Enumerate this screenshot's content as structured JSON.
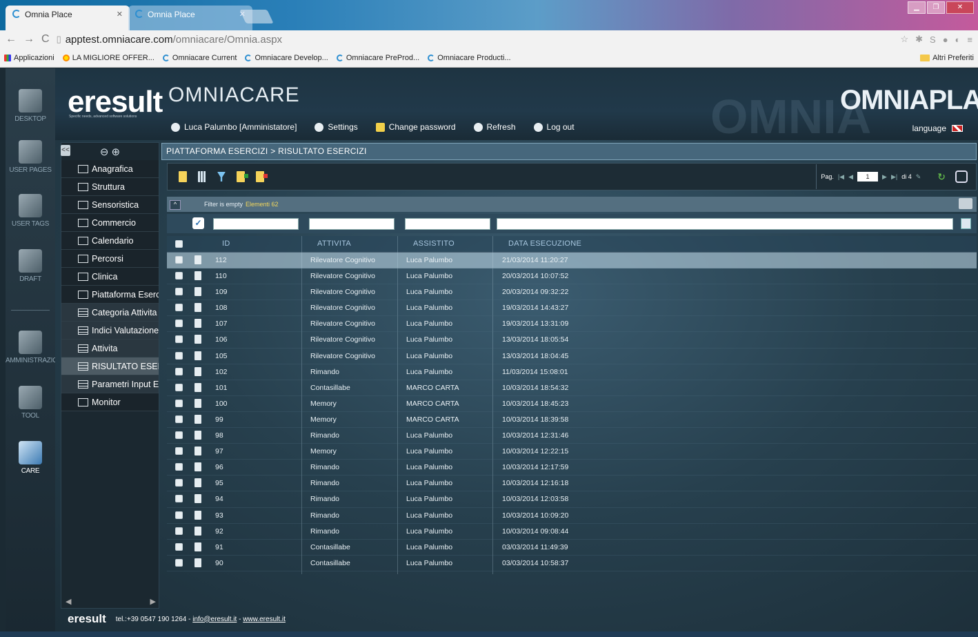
{
  "browser": {
    "tabs": [
      {
        "title": "Omnia Place",
        "active": true
      },
      {
        "title": "Omnia Place",
        "active": false
      }
    ],
    "url_host": "apptest.omniacare.com",
    "url_path": "/omniacare/Omnia.aspx",
    "bookmarks": [
      "Applicazioni",
      "LA MIGLIORE OFFER...",
      "Omniacare Current",
      "Omniacare Develop...",
      "Omniacare PreProd...",
      "Omniacare Producti..."
    ],
    "other_bookmarks": "Altri Preferiti"
  },
  "app": {
    "logo": "eresult",
    "logo_tagline": "Specific needs, advanced software solutions",
    "product": "OMNIACARE",
    "brand": "OMNIAPLACE",
    "user": "Luca Palumbo [Amministatore]",
    "toolbar": {
      "settings": "Settings",
      "change_password": "Change password",
      "refresh": "Refresh",
      "logout": "Log out"
    },
    "language": "language"
  },
  "leftbar": [
    "DESKTOP",
    "USER PAGES",
    "USER TAGS",
    "DRAFT",
    "AMMINISTRAZIONE",
    "TOOL",
    "CARE"
  ],
  "tree": {
    "collapse": "<<",
    "items": [
      {
        "label": "Anagrafica",
        "kind": "folder"
      },
      {
        "label": "Struttura",
        "kind": "folder"
      },
      {
        "label": "Sensoristica",
        "kind": "folder"
      },
      {
        "label": "Commercio",
        "kind": "folder"
      },
      {
        "label": "Calendario",
        "kind": "folder"
      },
      {
        "label": "Percorsi",
        "kind": "folder"
      },
      {
        "label": "Clinica",
        "kind": "folder"
      },
      {
        "label": "Piattaforma Esercizi",
        "kind": "folder-open"
      },
      {
        "label": "Categoria Attivita",
        "kind": "page"
      },
      {
        "label": "Indici Valutazione",
        "kind": "page"
      },
      {
        "label": "Attivita",
        "kind": "page"
      },
      {
        "label": "RISULTATO ESERCIZI",
        "kind": "page"
      },
      {
        "label": "Parametri Input Esercizi",
        "kind": "page"
      },
      {
        "label": "Monitor",
        "kind": "folder"
      }
    ]
  },
  "breadcrumb": "PIATTAFORMA ESERCIZI > RISULTATO ESERCIZI",
  "pager": {
    "label": "Pag.",
    "page": "1",
    "of": "di 4"
  },
  "filter": {
    "text": "Filter is empty",
    "count_label": "Elementi 62"
  },
  "table": {
    "columns": [
      "ID",
      "ATTIVITA",
      "ASSISTITO",
      "DATA ESECUZIONE"
    ],
    "rows": [
      [
        "112",
        "Rilevatore Cognitivo",
        "Luca Palumbo",
        "21/03/2014 11:20:27"
      ],
      [
        "110",
        "Rilevatore Cognitivo",
        "Luca Palumbo",
        "20/03/2014 10:07:52"
      ],
      [
        "109",
        "Rilevatore Cognitivo",
        "Luca Palumbo",
        "20/03/2014 09:32:22"
      ],
      [
        "108",
        "Rilevatore Cognitivo",
        "Luca Palumbo",
        "19/03/2014 14:43:27"
      ],
      [
        "107",
        "Rilevatore Cognitivo",
        "Luca Palumbo",
        "19/03/2014 13:31:09"
      ],
      [
        "106",
        "Rilevatore Cognitivo",
        "Luca Palumbo",
        "13/03/2014 18:05:54"
      ],
      [
        "105",
        "Rilevatore Cognitivo",
        "Luca Palumbo",
        "13/03/2014 18:04:45"
      ],
      [
        "102",
        "Rimando",
        "Luca Palumbo",
        "11/03/2014 15:08:01"
      ],
      [
        "101",
        "Contasillabe",
        "MARCO CARTA",
        "10/03/2014 18:54:32"
      ],
      [
        "100",
        "Memory",
        "MARCO CARTA",
        "10/03/2014 18:45:23"
      ],
      [
        "99",
        "Memory",
        "MARCO CARTA",
        "10/03/2014 18:39:58"
      ],
      [
        "98",
        "Rimando",
        "Luca Palumbo",
        "10/03/2014 12:31:46"
      ],
      [
        "97",
        "Memory",
        "Luca Palumbo",
        "10/03/2014 12:22:15"
      ],
      [
        "96",
        "Rimando",
        "Luca Palumbo",
        "10/03/2014 12:17:59"
      ],
      [
        "95",
        "Rimando",
        "Luca Palumbo",
        "10/03/2014 12:16:18"
      ],
      [
        "94",
        "Rimando",
        "Luca Palumbo",
        "10/03/2014 12:03:58"
      ],
      [
        "93",
        "Rimando",
        "Luca Palumbo",
        "10/03/2014 10:09:20"
      ],
      [
        "92",
        "Rimando",
        "Luca Palumbo",
        "10/03/2014 09:08:44"
      ],
      [
        "91",
        "Contasillabe",
        "Luca Palumbo",
        "03/03/2014 11:49:39"
      ],
      [
        "90",
        "Contasillabe",
        "Luca Palumbo",
        "03/03/2014 10:58:37"
      ]
    ]
  },
  "footer": {
    "logo": "eresult",
    "tel": "tel.:+39 0547 190 1264 -",
    "email": "info@eresult.it",
    "sep": "-",
    "site": "www.eresult.it"
  }
}
